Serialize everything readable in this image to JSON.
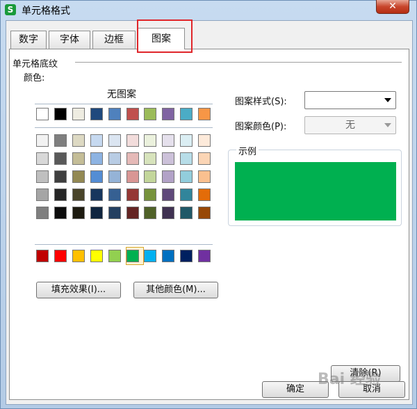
{
  "window": {
    "title": "单元格格式",
    "app_icon_glyph": "S",
    "close_glyph": "✕"
  },
  "tabs": [
    {
      "label": "数字"
    },
    {
      "label": "字体"
    },
    {
      "label": "边框"
    },
    {
      "label": "图案",
      "active": true
    }
  ],
  "shading": {
    "group_label": "单元格底纹",
    "color_label": "颜色:",
    "no_pattern_label": "无图案",
    "palette_rows": [
      [
        "#ffffff",
        "#000000",
        "#eeece1",
        "#1f497d",
        "#4f81bd",
        "#c0504d",
        "#9bbb59",
        "#8064a2",
        "#4bacc6",
        "#f79646"
      ],
      [
        "#f2f2f2",
        "#7f7f7f",
        "#ddd9c3",
        "#c6d9f0",
        "#dbe5f1",
        "#f2dcdb",
        "#ebf1dd",
        "#e5e0ec",
        "#dbeef3",
        "#fdeada"
      ],
      [
        "#d8d8d8",
        "#595959",
        "#c4bd97",
        "#8db3e2",
        "#b8cce4",
        "#e5b9b7",
        "#d7e3bc",
        "#ccc1d9",
        "#b7dde8",
        "#fbd5b5"
      ],
      [
        "#bfbfbf",
        "#3f3f3f",
        "#938953",
        "#548dd4",
        "#95b3d7",
        "#d99694",
        "#c3d69b",
        "#b2a2c7",
        "#92cddc",
        "#fac08f"
      ],
      [
        "#a5a5a5",
        "#262626",
        "#494429",
        "#17365d",
        "#366092",
        "#953734",
        "#76923c",
        "#5f497a",
        "#31859b",
        "#e36c09"
      ],
      [
        "#7f7f7f",
        "#0c0c0c",
        "#1d1b10",
        "#0f243e",
        "#244061",
        "#632423",
        "#4f6128",
        "#3f3151",
        "#205867",
        "#974806"
      ]
    ],
    "standard_colors": [
      "#c00000",
      "#ff0000",
      "#ffc000",
      "#ffff00",
      "#92d050",
      "#00b050",
      "#00b0f0",
      "#0070c0",
      "#002060",
      "#7030a0"
    ],
    "selected_color": "#00b050",
    "fill_effects_button": "填充效果(I)...",
    "more_colors_button": "其他颜色(M)..."
  },
  "pattern": {
    "style_label": "图案样式(S):",
    "style_value": "",
    "color_label": "图案颜色(P):",
    "color_value": "无"
  },
  "sample": {
    "label": "示例",
    "fill_color": "#00b050"
  },
  "buttons": {
    "clear": "清除(R)",
    "ok": "确定",
    "cancel": "取消"
  },
  "watermark": "Bai 经验"
}
